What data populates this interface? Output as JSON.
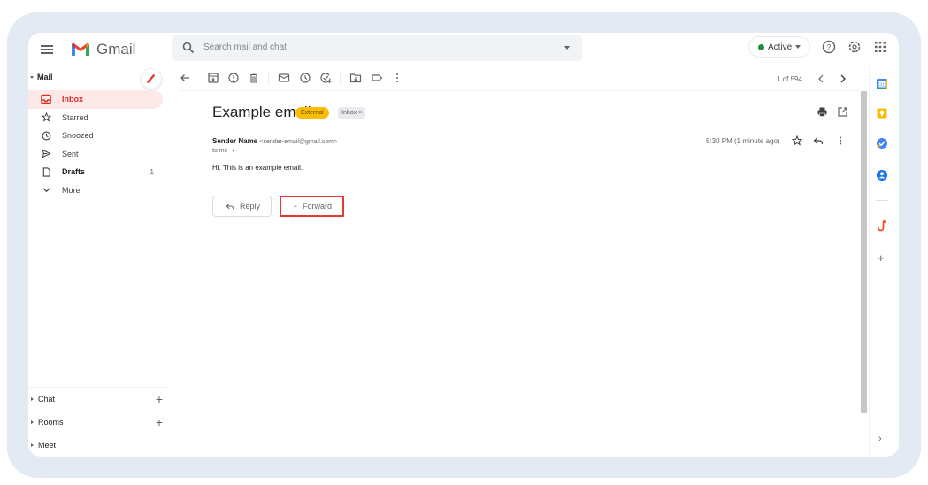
{
  "app": {
    "name": "Gmail",
    "search_placeholder": "Search mail and chat",
    "status_label": "Active",
    "status_color": "#1e8e3e",
    "header_icons": [
      "help-icon",
      "settings-icon",
      "apps-grid-icon"
    ]
  },
  "sidebar": {
    "mail_section": "Mail",
    "compose_icon": "pencil-icon",
    "items": [
      {
        "label": "Inbox",
        "icon": "inbox-icon",
        "active": true,
        "count": ""
      },
      {
        "label": "Starred",
        "icon": "star-icon",
        "active": false,
        "count": ""
      },
      {
        "label": "Snoozed",
        "icon": "clock-icon",
        "active": false,
        "count": ""
      },
      {
        "label": "Sent",
        "icon": "send-icon",
        "active": false,
        "count": ""
      },
      {
        "label": "Drafts",
        "icon": "draft-icon",
        "active": false,
        "count": "1"
      },
      {
        "label": "More",
        "icon": "chevron-down-icon",
        "active": false,
        "count": ""
      }
    ],
    "sections": [
      {
        "label": "Chat",
        "has_add": true
      },
      {
        "label": "Rooms",
        "has_add": true
      },
      {
        "label": "Meet",
        "has_add": false
      }
    ]
  },
  "toolbar": {
    "icons": [
      "back-arrow-icon",
      "archive-icon",
      "report-spam-icon",
      "delete-icon",
      "mark-unread-icon",
      "snooze-icon",
      "add-task-icon",
      "move-to-icon",
      "label-icon",
      "more-vert-icon"
    ],
    "pager": "1 of 594"
  },
  "message": {
    "subject": "Example email",
    "badges": {
      "external": "External",
      "inbox": "Inbox ×"
    },
    "sender_name": "Sender Name",
    "sender_email": "<sender-email@gmail.com>",
    "to": "to me",
    "time": "5:30 PM (1 minute ago)",
    "body": "Hi. This is an example email.",
    "actions": {
      "reply": "Reply",
      "forward": "Forward"
    }
  },
  "side_panel": {
    "apps": [
      "calendar-icon",
      "keep-icon",
      "tasks-icon",
      "contacts-icon",
      "addon-icon"
    ],
    "add_label": "+",
    "expand_label": "›"
  }
}
